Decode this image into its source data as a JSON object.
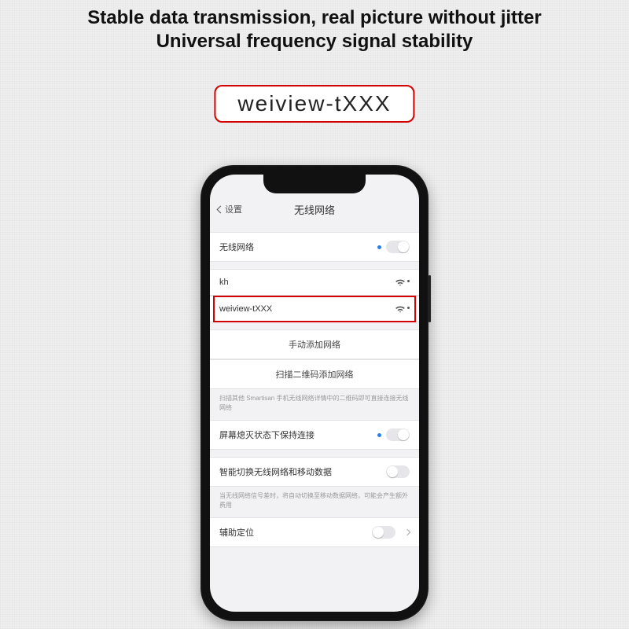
{
  "headline": {
    "line1": "Stable data transmission, real picture without jitter",
    "line2": "Universal frequency signal stability"
  },
  "pill": "weiview-tXXX",
  "nav": {
    "back": "设置",
    "title": "无线网络"
  },
  "rows": {
    "wifi_toggle": "无线网络",
    "net_kh": "kh",
    "net_weiview": "weiview-tXXX",
    "add_manual": "手动添加网络",
    "add_qr": "扫描二维码添加网络",
    "qr_note": "扫描其他 Smartisan 手机无线网络详情中的二维码即可直接连接无线网络",
    "keep_screen": "屏幕熄灭状态下保持连接",
    "smart_switch": "智能切换无线网络和移动数据",
    "switch_note": "当无线网络信号差时，将自动切换至移动数据网络，可能会产生额外费用",
    "assist_loc": "辅助定位"
  }
}
